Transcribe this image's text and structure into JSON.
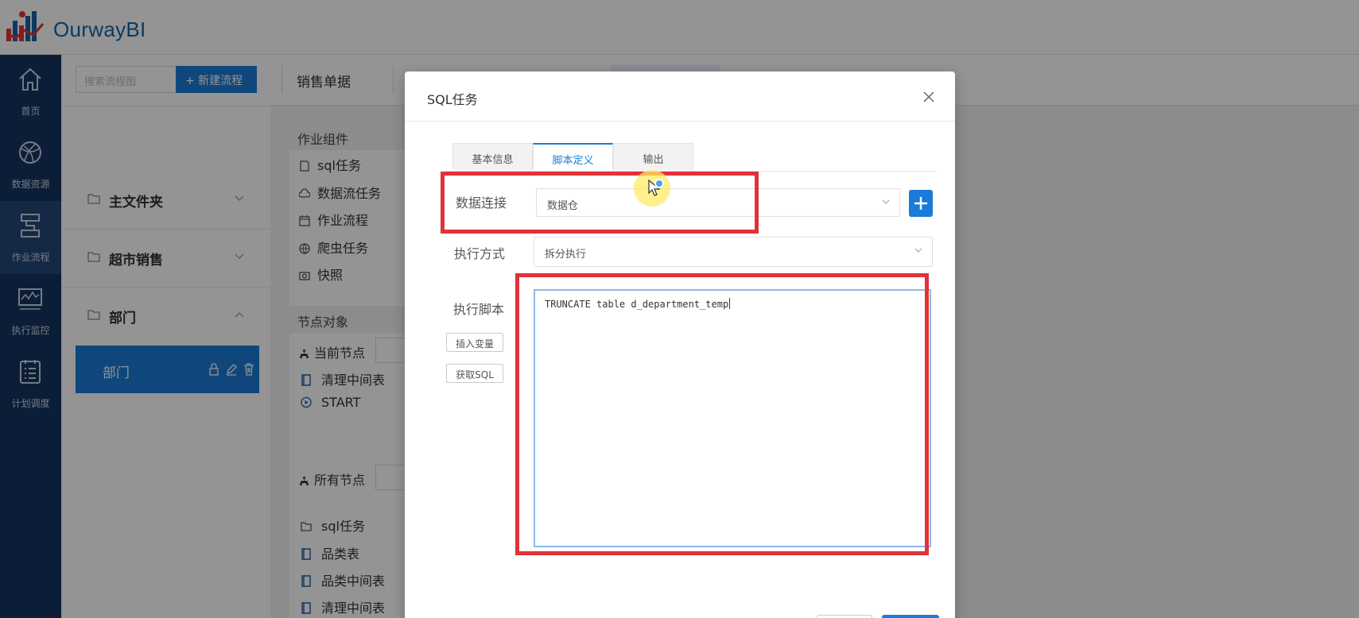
{
  "app": {
    "brand": "OurwayBI",
    "colors": {
      "primary": "#1a7bd8",
      "nav_bg": "#163560",
      "annotation": "#e03238"
    }
  },
  "leftnav": {
    "items": [
      {
        "label": "首页",
        "icon": "home-icon"
      },
      {
        "label": "数据资源",
        "icon": "globe-icon"
      },
      {
        "label": "作业流程",
        "icon": "workflow-icon",
        "active": true
      },
      {
        "label": "执行监控",
        "icon": "monitor-icon"
      },
      {
        "label": "计划调度",
        "icon": "schedule-list-icon"
      }
    ]
  },
  "flow_tree": {
    "search_placeholder": "搜索流程图",
    "new_flow_label": "+ 新建流程",
    "folders": [
      {
        "label": "主文件夹",
        "expanded": false
      },
      {
        "label": "超市销售",
        "expanded": false
      },
      {
        "label": "部门",
        "expanded": true
      }
    ],
    "selected_flow": "部门"
  },
  "editor_tab": {
    "title": "销售单据"
  },
  "components": {
    "section_title": "作业组件",
    "items": [
      {
        "label": "sql任务",
        "icon": "document-icon"
      },
      {
        "label": "数据流任务",
        "icon": "cloud-icon"
      },
      {
        "label": "作业流程",
        "icon": "calendar-icon"
      },
      {
        "label": "爬虫任务",
        "icon": "globe-icon"
      },
      {
        "label": "快照",
        "icon": "camera-icon"
      }
    ],
    "nodes_title": "节点对象",
    "current_node_label": "当前节点",
    "current_nodes": [
      {
        "label": "清理中间表",
        "icon": "sql-node-icon"
      },
      {
        "label": "START",
        "icon": "start-icon"
      }
    ],
    "all_nodes_label": "所有节点",
    "all_nodes": [
      {
        "label": "sql任务",
        "icon": "folder-icon"
      },
      {
        "label": "品类表",
        "icon": "sql-node-icon"
      },
      {
        "label": "品类中间表",
        "icon": "sql-node-icon"
      },
      {
        "label": "清理中间表",
        "icon": "sql-node-icon"
      }
    ]
  },
  "modal": {
    "title": "SQL任务",
    "tabs": [
      {
        "label": "基本信息",
        "active": false
      },
      {
        "label": "脚本定义",
        "active": true
      },
      {
        "label": "输出",
        "active": false
      }
    ],
    "data_connection": {
      "label": "数据连接",
      "value": "数据仓"
    },
    "exec_mode": {
      "label": "执行方式",
      "value": "拆分执行"
    },
    "exec_script": {
      "label": "执行脚本",
      "insert_variable_label": "插入变量",
      "get_sql_label": "获取SQL",
      "value": "TRUNCATE table d_department_temp"
    }
  }
}
